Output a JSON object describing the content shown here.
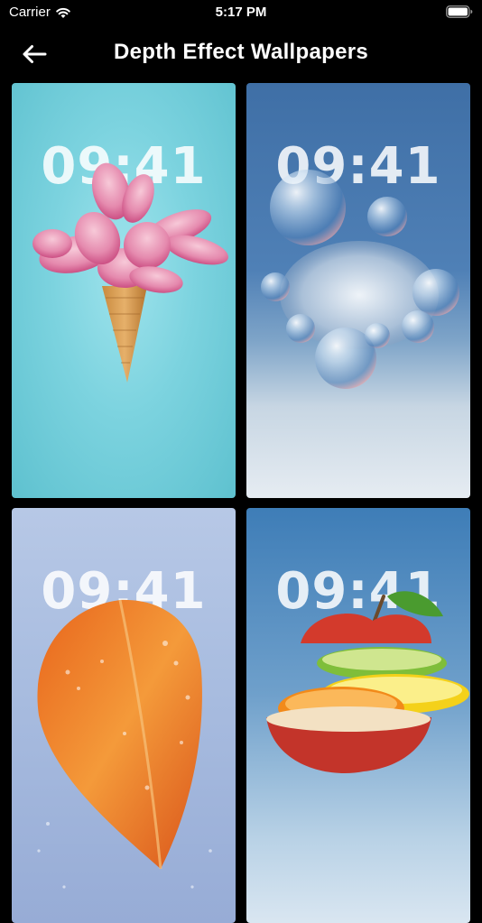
{
  "status_bar": {
    "carrier": "Carrier",
    "time": "5:17 PM",
    "icons": [
      "wifi-icon",
      "battery-icon"
    ]
  },
  "nav": {
    "title": "Depth Effect Wallpapers",
    "back_icon": "arrow-left-icon"
  },
  "wallpapers": [
    {
      "clock": "09:41",
      "subject": "flower-ice-cream-cone"
    },
    {
      "clock": "09:41",
      "subject": "bubbles-fluff"
    },
    {
      "clock": "09:41",
      "subject": "orange-leaf"
    },
    {
      "clock": "09:41",
      "subject": "sliced-fruit-stack"
    }
  ],
  "colors": {
    "background": "#000000",
    "text": "#ffffff"
  }
}
